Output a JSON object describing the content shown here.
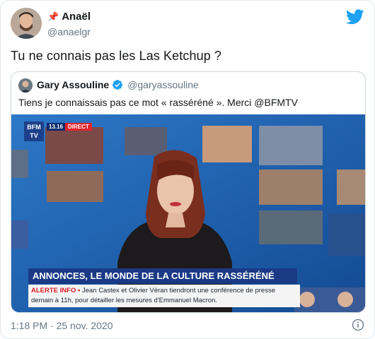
{
  "tweet": {
    "author_name": "Anaël",
    "author_handle": "@anaelgr",
    "pin_icon": "pin-icon",
    "text": "Tu ne connais pas les Las Ketchup ?",
    "timestamp": "1:18 PM · 25 nov. 2020"
  },
  "quoted_tweet": {
    "author_name": "Gary Assouline",
    "author_handle": "@garyassouline",
    "text": "Tiens je connaissais pas ce mot « rasséréné ». Merci @BFMTV"
  },
  "tv_screen": {
    "channel_logo": "BFM TV",
    "live_time": "13.16",
    "live_label": "DIRECT",
    "headline": "ANNONCES, LE MONDE DE LA CULTURE RASSÉRÉNÉ",
    "alert_label": "ALERTE INFO •",
    "alert_text": "Jean Castex et Olivier Véran tiendront une conférence de presse demain à 11h, pour détailler les mesures d'Emmanuel Macron."
  },
  "colors": {
    "twitter_blue": "#1DA1F2",
    "bfm_blue": "#1a3a86",
    "alert_red": "#d81e24"
  }
}
